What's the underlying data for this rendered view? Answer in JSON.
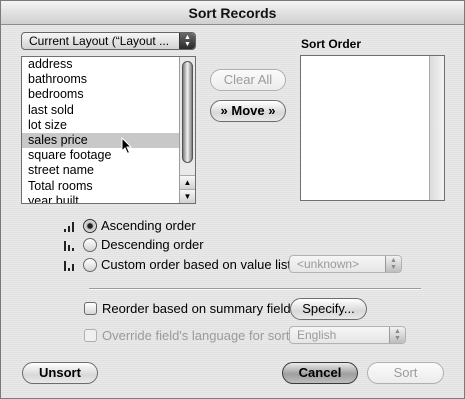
{
  "window": {
    "title": "Sort Records"
  },
  "layout_popup": {
    "value": "Current Layout (“Layout ..."
  },
  "fields": [
    {
      "label": "address"
    },
    {
      "label": "bathrooms"
    },
    {
      "label": "bedrooms"
    },
    {
      "label": "last sold"
    },
    {
      "label": "lot size"
    },
    {
      "label": "sales price",
      "selected": true
    },
    {
      "label": "square footage"
    },
    {
      "label": "street name"
    },
    {
      "label": "Total rooms"
    },
    {
      "label": "year built"
    }
  ],
  "buttons": {
    "clear_all": "Clear All",
    "move": "» Move »",
    "specify": "Specify...",
    "unsort": "Unsort",
    "cancel": "Cancel",
    "sort": "Sort"
  },
  "sort_order": {
    "label": "Sort Order"
  },
  "orders": {
    "ascending": "Ascending order",
    "descending": "Descending order",
    "custom": "Custom order based on value list",
    "selected": "ascending"
  },
  "value_list_popup": {
    "value": "<unknown>"
  },
  "options": {
    "reorder_summary": "Reorder based on summary field",
    "override_language": "Override field's language for sort"
  },
  "language_popup": {
    "value": "English"
  }
}
